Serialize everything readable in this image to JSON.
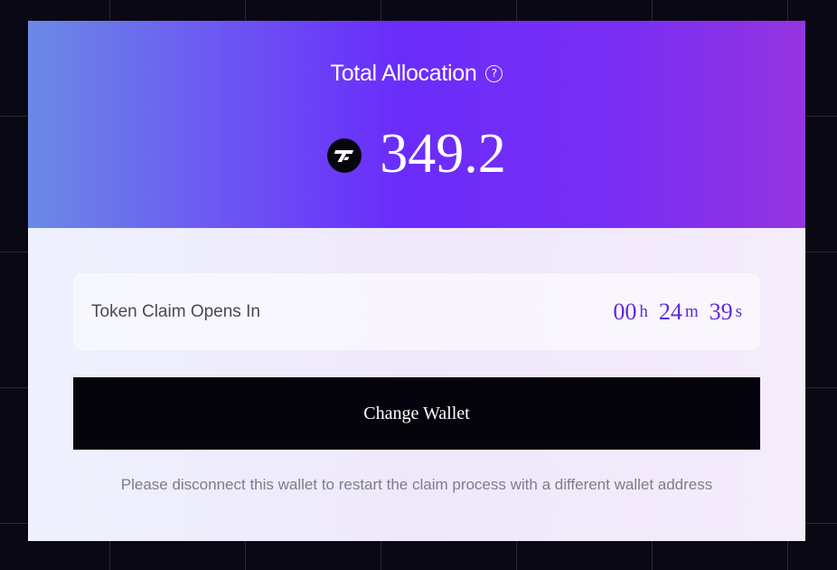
{
  "header": {
    "title": "Total Allocation",
    "help_icon": "question-circle-icon",
    "help_glyph": "?",
    "token_icon": "token-logo-icon",
    "amount": "349.2"
  },
  "countdown": {
    "label": "Token Claim Opens In",
    "hours": "00",
    "hours_unit": "h",
    "minutes": "24",
    "minutes_unit": "m",
    "seconds": "39",
    "seconds_unit": "s"
  },
  "actions": {
    "change_wallet_label": "Change Wallet"
  },
  "note": "Please disconnect this wallet to restart the claim process with a different wallet address",
  "colors": {
    "background": "#0a0814",
    "header_gradient_start": "#6a8ae6",
    "header_gradient_mid": "#6a2cfb",
    "header_gradient_end": "#9535e0",
    "timer_accent": "#5b2bdc",
    "button_bg": "#05030c"
  }
}
